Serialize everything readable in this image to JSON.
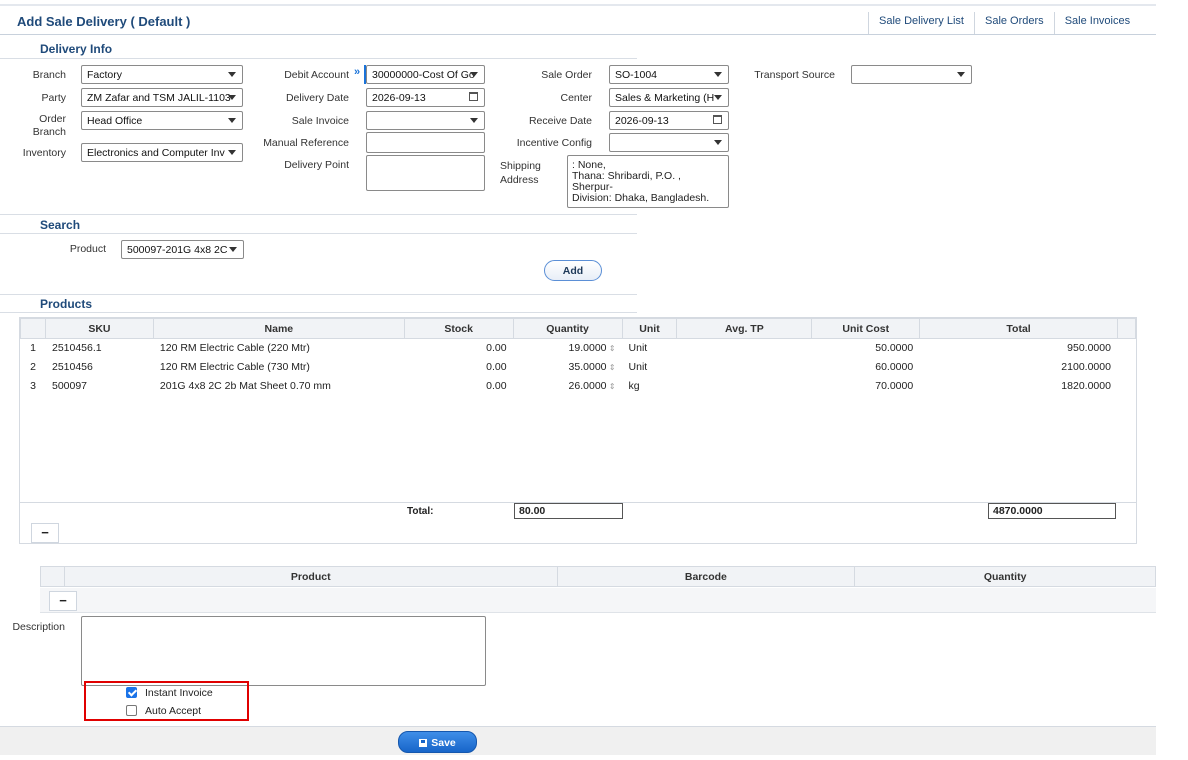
{
  "header": {
    "title": "Add Sale Delivery ( Default )",
    "links": [
      "Sale Delivery List",
      "Sale Orders",
      "Sale Invoices"
    ]
  },
  "delivery_info": {
    "section_title": "Delivery Info",
    "branch": {
      "label": "Branch",
      "value": "Factory"
    },
    "party": {
      "label": "Party",
      "value": "ZM Zafar and TSM JALIL-1103"
    },
    "order_branch": {
      "label": "Order Branch",
      "value": "Head Office"
    },
    "inventory": {
      "label": "Inventory",
      "value": "Electronics and Computer Inv"
    },
    "debit_account": {
      "label": "Debit Account",
      "value": "30000000-Cost Of Go"
    },
    "delivery_date": {
      "label": "Delivery Date",
      "value": "2026-09-13"
    },
    "sale_invoice": {
      "label": "Sale Invoice",
      "value": ""
    },
    "manual_reference": {
      "label": "Manual Reference",
      "value": ""
    },
    "delivery_point": {
      "label": "Delivery Point",
      "value": ""
    },
    "sale_order": {
      "label": "Sale Order",
      "value": "SO-1004"
    },
    "center": {
      "label": "Center",
      "value": "Sales & Marketing (H"
    },
    "receive_date": {
      "label": "Receive Date",
      "value": "2026-09-13"
    },
    "incentive_config": {
      "label": "Incentive Config",
      "value": ""
    },
    "shipping_address": {
      "label": "Shipping Address",
      "lines": [
        ": None,",
        "Thana: Shribardi, P.O. ,",
        "Sherpur-",
        "Division: Dhaka, Bangladesh."
      ]
    },
    "transport_source": {
      "label": "Transport Source",
      "value": ""
    }
  },
  "search": {
    "section_title": "Search",
    "product_label": "Product",
    "product_value": "500097-201G 4x8 2C",
    "add_label": "Add"
  },
  "products": {
    "section_title": "Products",
    "columns": [
      "SKU",
      "Name",
      "Stock",
      "Quantity",
      "Unit",
      "Avg. TP",
      "Unit Cost",
      "Total"
    ],
    "rows": [
      {
        "idx": "1",
        "sku": "2510456.1",
        "name": "120 RM Electric Cable (220 Mtr)",
        "stock": "0.00",
        "qty": "19.0000",
        "unit": "Unit",
        "avg_tp": "",
        "unit_cost": "50.0000",
        "total": "950.0000"
      },
      {
        "idx": "2",
        "sku": "2510456",
        "name": "120 RM Electric Cable (730 Mtr)",
        "stock": "0.00",
        "qty": "35.0000",
        "unit": "Unit",
        "avg_tp": "",
        "unit_cost": "60.0000",
        "total": "2100.0000"
      },
      {
        "idx": "3",
        "sku": "500097",
        "name": "201G 4x8 2C 2b Mat Sheet 0.70 mm",
        "stock": "0.00",
        "qty": "26.0000",
        "unit": "kg",
        "avg_tp": "",
        "unit_cost": "70.0000",
        "total": "1820.0000"
      }
    ],
    "total_label": "Total:",
    "total_qty": "80.00",
    "total_amount": "4870.0000",
    "minus_label": "−"
  },
  "barcode_grid": {
    "columns": [
      "Product",
      "Barcode",
      "Quantity"
    ],
    "minus_label": "−"
  },
  "description": {
    "label": "Description",
    "value": ""
  },
  "options": {
    "instant_invoice": {
      "label": "Instant Invoice",
      "checked": true
    },
    "auto_accept": {
      "label": "Auto Accept",
      "checked": false
    }
  },
  "footer": {
    "save_label": "Save"
  }
}
